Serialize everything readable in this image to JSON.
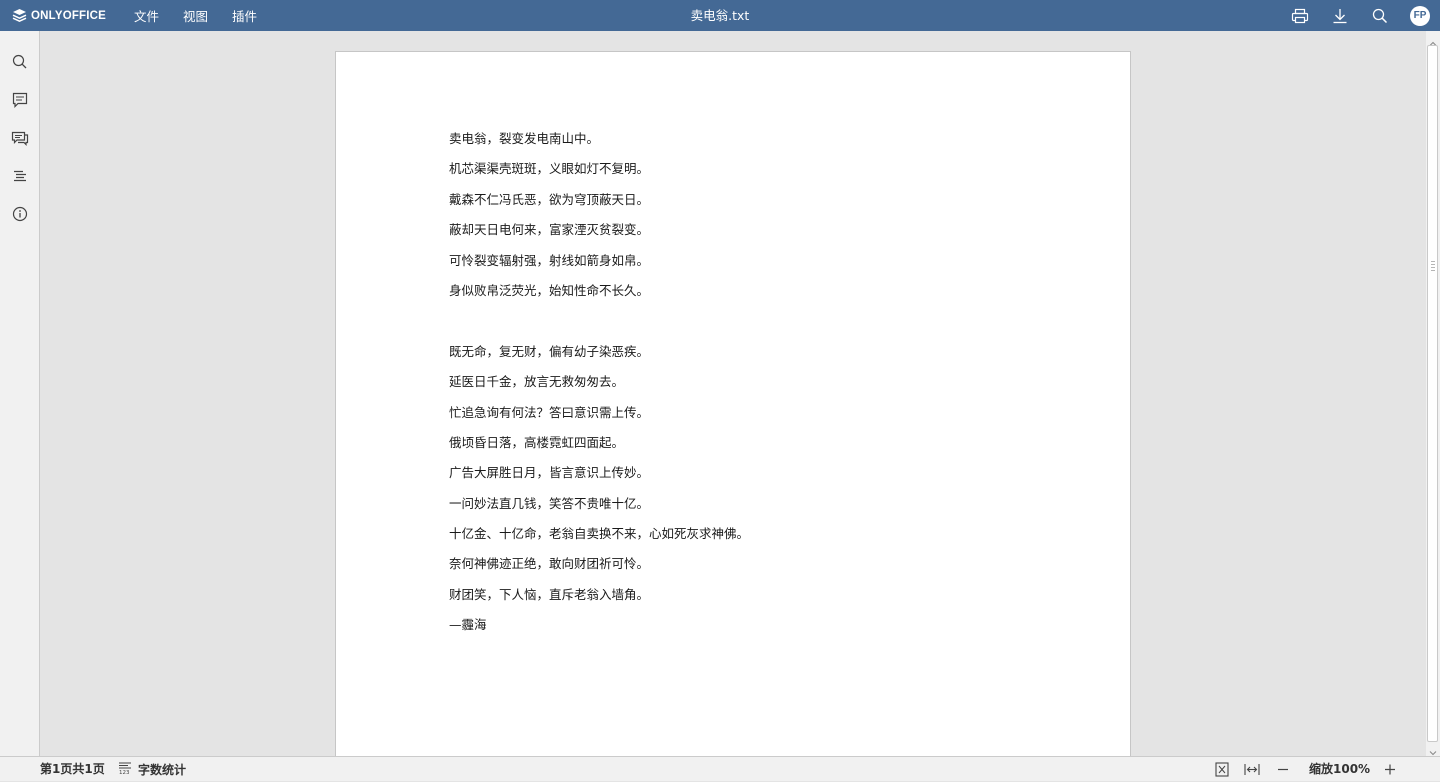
{
  "app": {
    "brand": "ONLYOFFICE",
    "brand_color": "#446995",
    "logo_icon": "onlyoffice-layers-icon"
  },
  "header": {
    "menu": [
      {
        "label": "文件"
      },
      {
        "label": "视图"
      },
      {
        "label": "插件"
      }
    ],
    "title": "卖电翁.txt",
    "actions": [
      {
        "icon": "print-icon"
      },
      {
        "icon": "download-icon"
      },
      {
        "icon": "search-icon"
      }
    ],
    "avatar_initials": "FP"
  },
  "sidebar": {
    "items": [
      {
        "icon": "search-icon"
      },
      {
        "icon": "comments-icon"
      },
      {
        "icon": "chat-icon"
      },
      {
        "icon": "navigation-icon"
      },
      {
        "icon": "info-icon"
      }
    ]
  },
  "document": {
    "lines": [
      "卖电翁，裂变发电南山中。",
      "机芯渠渠壳斑斑，义眼如灯不复明。",
      "戴森不仁冯氏恶，欲为穹顶蔽天日。",
      "蔽却天日电何来，富家湮灭贫裂变。",
      "可怜裂变辐射强，射线如箭身如帛。",
      "身似败帛泛荧光，始知性命不长久。",
      "",
      "既无命，复无财，偏有幼子染恶疾。",
      "延医日千金，放言无救匆匆去。",
      "忙追急询有何法？答曰意识需上传。",
      "俄顷昏日落，高楼霓虹四面起。",
      "广告大屏胜日月，皆言意识上传妙。",
      "一问妙法直几钱，笑答不贵唯十亿。",
      "十亿金、十亿命，老翁自卖换不来，心如死灰求神佛。",
      "奈何神佛迹正绝，敢向财团祈可怜。",
      "财团笑，下人恼，直斥老翁入墙角。",
      "—霾海"
    ]
  },
  "statusbar": {
    "page_info": "第1页共1页",
    "word_count_label": "字数统计",
    "word_count_icon": "word-count-icon",
    "fit_page_icon": "fit-page-icon",
    "fit_width_icon": "fit-width-icon",
    "zoom_out_icon": "zoom-out-icon",
    "zoom_label": "缩放100%",
    "zoom_in_icon": "zoom-in-icon"
  }
}
